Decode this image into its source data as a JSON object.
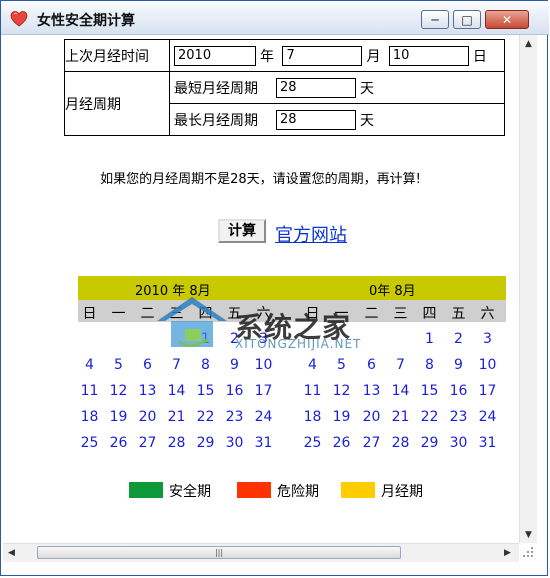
{
  "window": {
    "title": "女性安全期计算",
    "min_symbol": "─",
    "max_symbol": "□",
    "close_symbol": "✕"
  },
  "form": {
    "last_period_label": "上次月经时间",
    "year_value": "2010",
    "year_unit": "年",
    "month_value": "7",
    "month_unit": "月",
    "day_value": "10",
    "day_unit": "日",
    "cycle_label": "月经周期",
    "shortest_label": "最短月经周期",
    "shortest_value": "28",
    "shortest_unit": "天",
    "longest_label": "最长月经周期",
    "longest_value": "28",
    "longest_unit": "天"
  },
  "message": "如果您的月经周期不是28天，请设置您的周期，再计算!",
  "calculate_label": "计算",
  "website_link": "官方网站",
  "calendar": {
    "left_title": "2010 年 8月",
    "right_title": "0年 8月",
    "weekdays": [
      "日",
      "一",
      "二",
      "三",
      "四",
      "五",
      "六"
    ],
    "days": [
      [
        "",
        "",
        "",
        "",
        "1",
        "2",
        "3"
      ],
      [
        "4",
        "5",
        "6",
        "7",
        "8",
        "9",
        "10"
      ],
      [
        "11",
        "12",
        "13",
        "14",
        "15",
        "16",
        "17"
      ],
      [
        "18",
        "19",
        "20",
        "21",
        "22",
        "23",
        "24"
      ],
      [
        "25",
        "26",
        "27",
        "28",
        "29",
        "30",
        "31"
      ]
    ]
  },
  "legend": [
    {
      "label": "安全期",
      "color": "#0e9a3a"
    },
    {
      "label": "危险期",
      "color": "#ff3300"
    },
    {
      "label": "月经期",
      "color": "#ffcc00"
    }
  ],
  "watermark": {
    "title": "系统之家",
    "subtitle": "XITONGZHIJIA.NET"
  },
  "scrollbars": {
    "up": "▲",
    "down": "▼",
    "left": "◀",
    "right": "▶",
    "grip": "|||"
  }
}
